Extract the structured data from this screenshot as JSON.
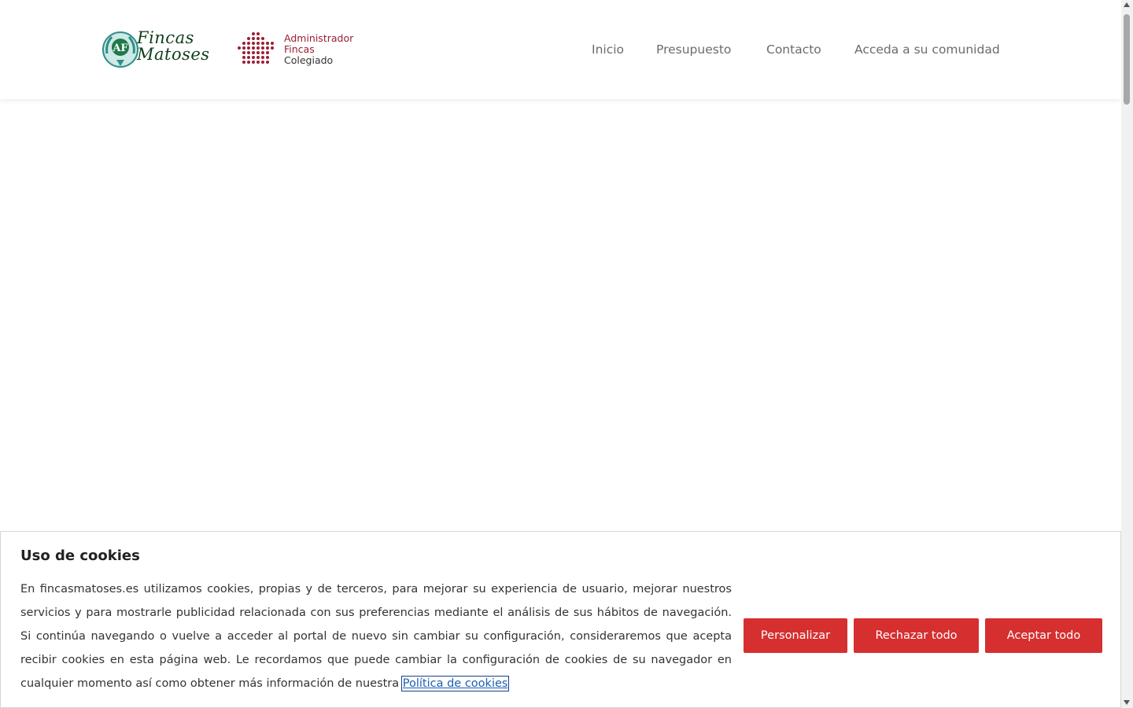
{
  "header": {
    "logo_fincas": {
      "line1": "Fincas",
      "line2": "Matoses",
      "emblem_text": "AF"
    },
    "logo_admin": {
      "line1": "Administrador",
      "line2": "Fincas",
      "line3": "Colegiado"
    },
    "nav": [
      {
        "label": "Inicio"
      },
      {
        "label": "Presupuesto"
      },
      {
        "label": "Contacto"
      },
      {
        "label": "Acceda a su comunidad"
      }
    ]
  },
  "cookie_banner": {
    "title": "Uso de cookies",
    "body": "En fincasmatoses.es utilizamos cookies, propias y de terceros, para mejorar su experiencia de usuario, mejorar nuestros servicios y para mostrarle publicidad relacionada con sus preferencias mediante el análisis de sus hábitos de navegación. Si continúa navegando o vuelve a acceder al portal de nuevo sin cambiar su configuración, consideraremos que acepta recibir cookies en esta página web. Le recordamos que puede cambiar la configuración de cookies de su navegador en cualquier momento así como obtener más información de nuestra",
    "link_label": "Política de cookies",
    "buttons": {
      "customize": "Personalizar",
      "reject": "Rechazar todo",
      "accept": "Aceptar todo"
    }
  },
  "colors": {
    "accent_red": "#d62f2f",
    "brand_green": "#0d3f1a",
    "brand_maroon": "#9a1e32"
  }
}
